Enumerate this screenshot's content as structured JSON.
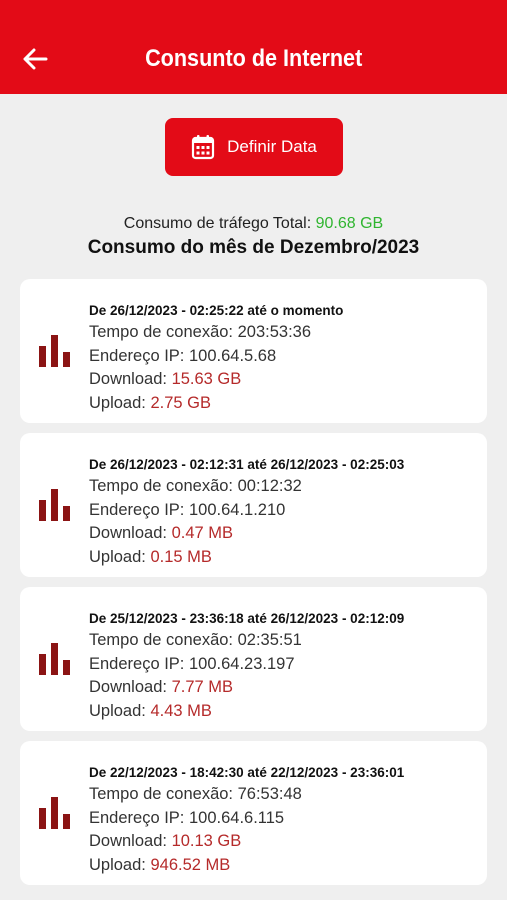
{
  "header": {
    "title": "Consunto de Internet"
  },
  "date_button": {
    "label": "Definir Data"
  },
  "summary": {
    "total_label": "Consumo de tráfego Total:",
    "total_value": "90.68 GB",
    "month_title": "Consumo do mês de Dezembro/2023"
  },
  "labels": {
    "connection_time": "Tempo de conexão:",
    "ip": "Endereço IP:",
    "download": "Download:",
    "upload": "Upload:"
  },
  "sessions": [
    {
      "range": "De 26/12/2023 - 02:25:22 até o momento",
      "connection_time": "203:53:36",
      "ip": "100.64.5.68",
      "download": "15.63 GB",
      "upload": "2.75 GB"
    },
    {
      "range": "De 26/12/2023 - 02:12:31 até 26/12/2023 - 02:25:03",
      "connection_time": "00:12:32",
      "ip": "100.64.1.210",
      "download": "0.47 MB",
      "upload": "0.15 MB"
    },
    {
      "range": "De 25/12/2023 - 23:36:18 até 26/12/2023 - 02:12:09",
      "connection_time": "02:35:51",
      "ip": "100.64.23.197",
      "download": "7.77 MB",
      "upload": "4.43 MB"
    },
    {
      "range": "De 22/12/2023 - 18:42:30 até 22/12/2023 - 23:36:01",
      "connection_time": "76:53:48",
      "ip": "100.64.6.115",
      "download": "10.13 GB",
      "upload": "946.52 MB"
    }
  ],
  "colors": {
    "brand": "#e30b17",
    "total_value": "#2fb52f",
    "metric_value": "#b52a2a",
    "icon": "#8b1414"
  },
  "icons": {
    "back": "arrow-left-icon",
    "calendar": "calendar-icon",
    "session": "bar-chart-icon"
  }
}
